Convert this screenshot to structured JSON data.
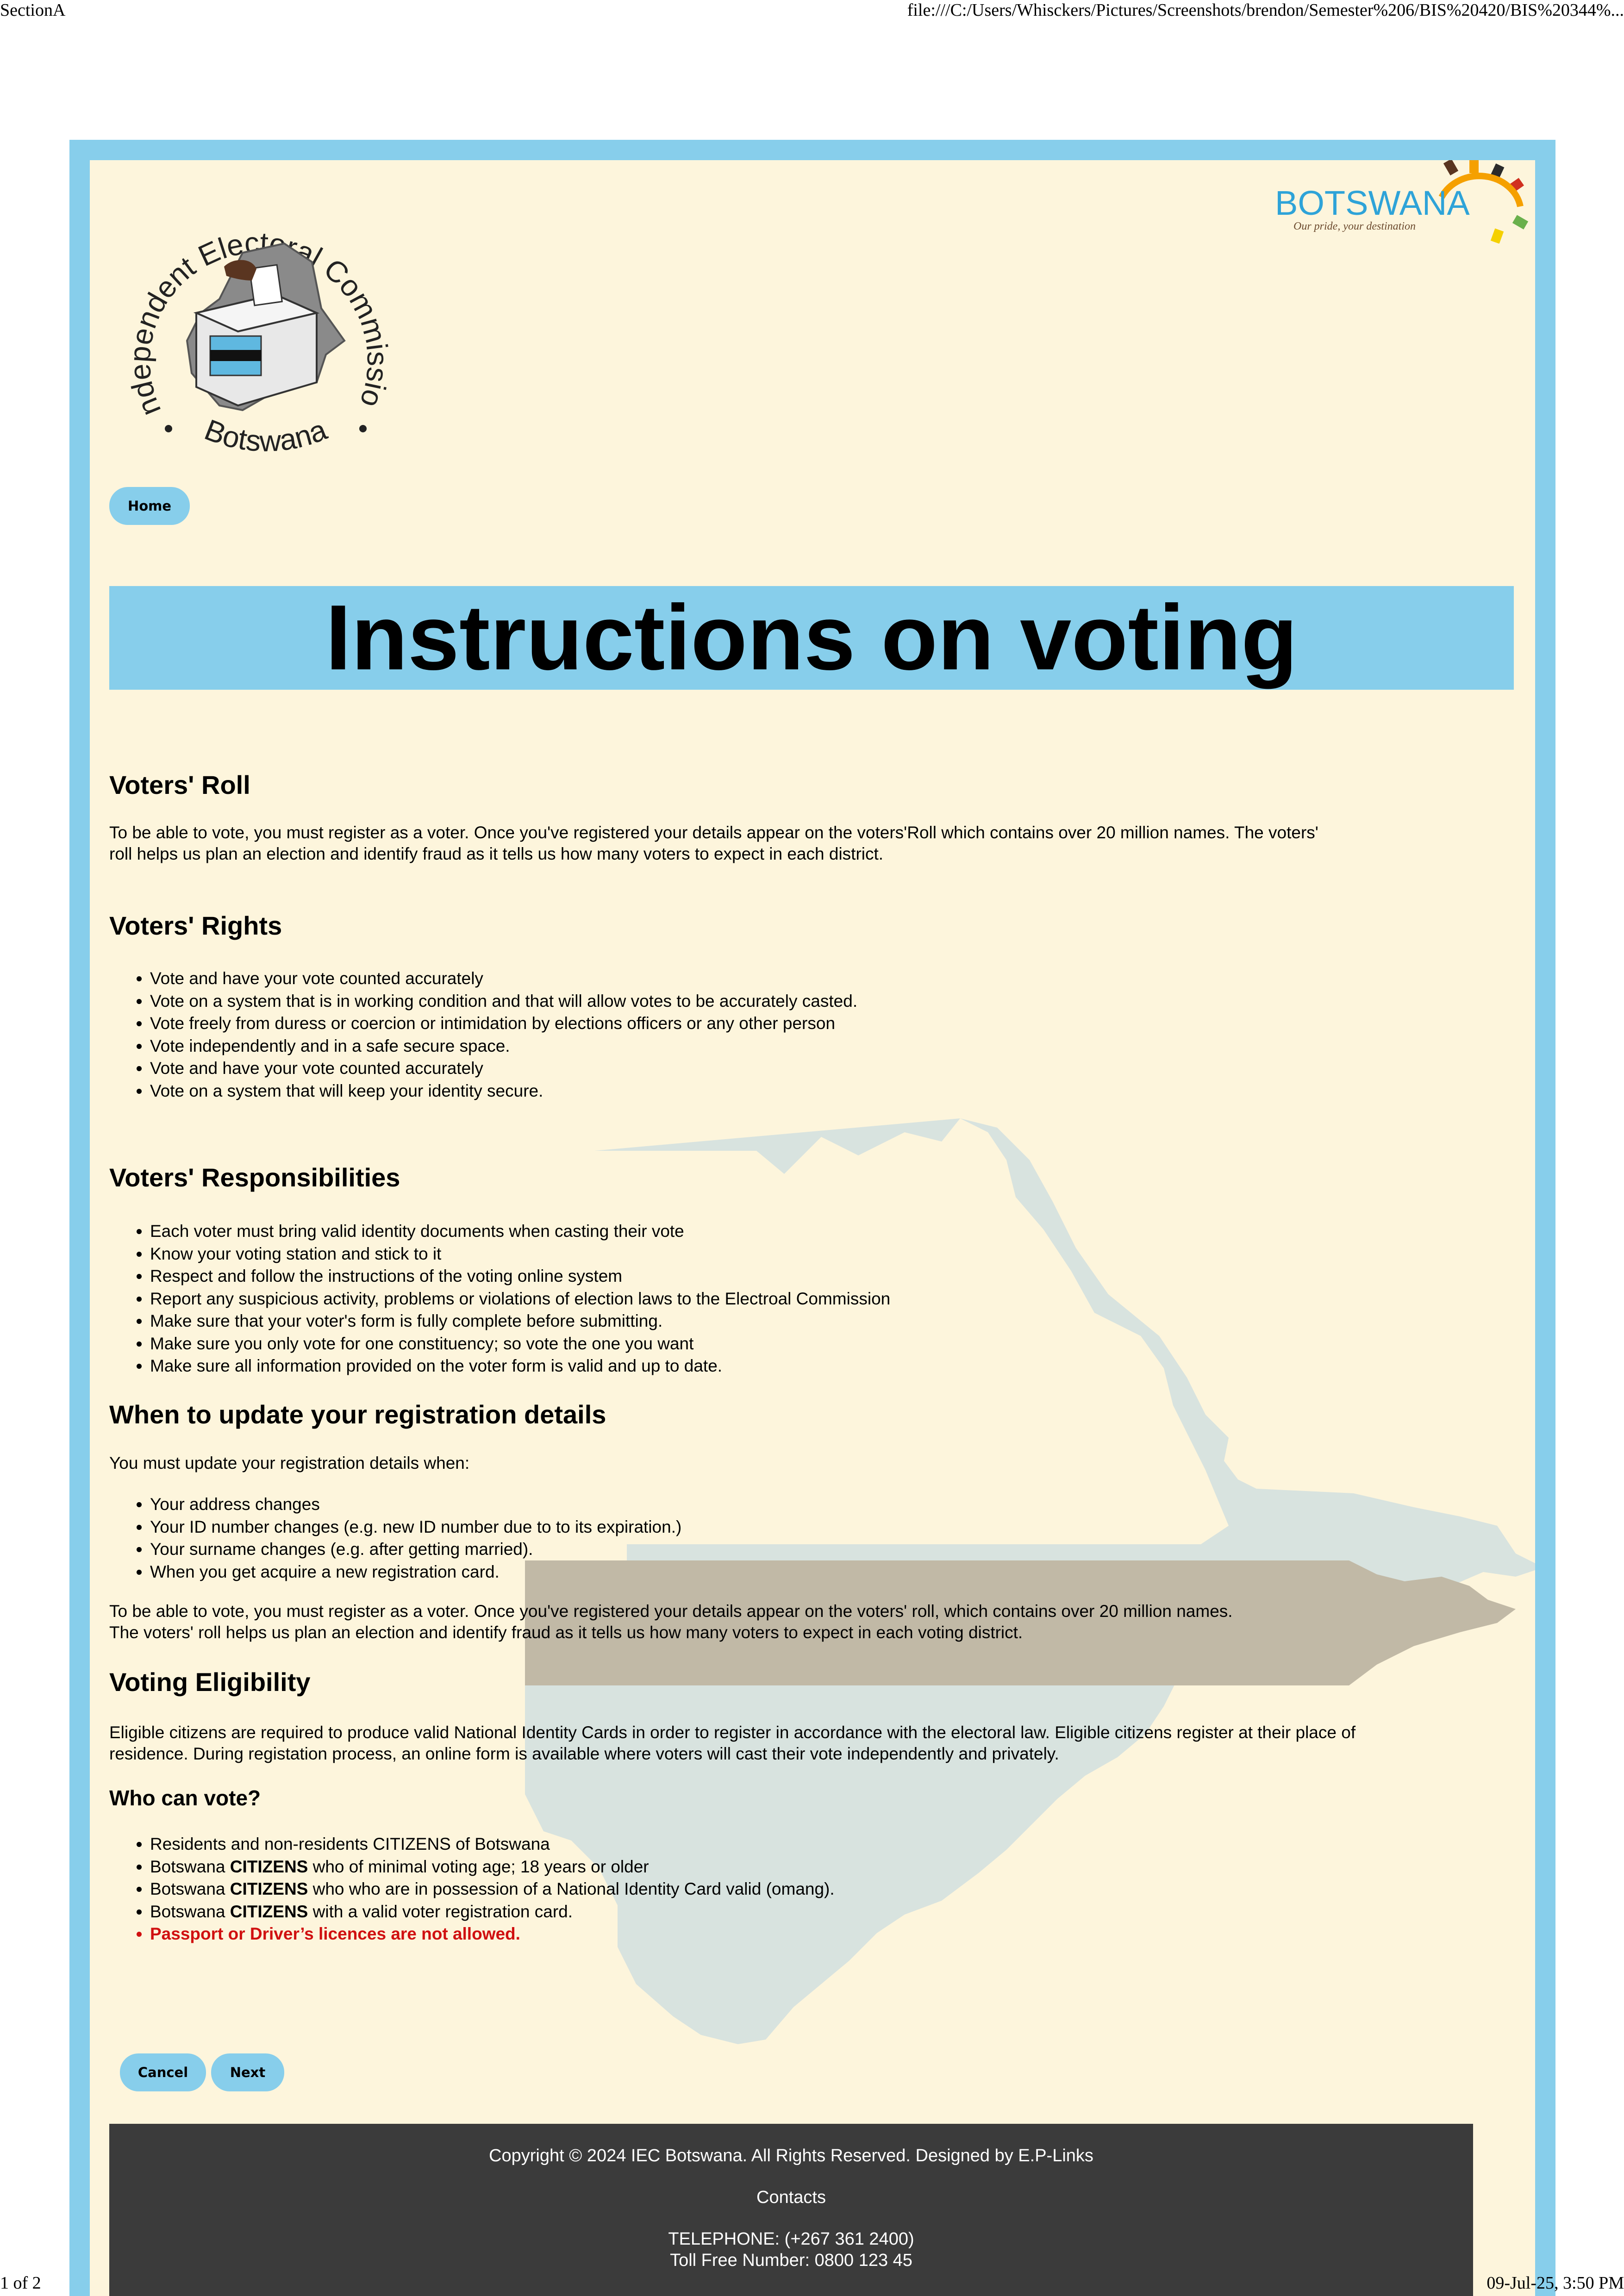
{
  "print_header": {
    "title": "SectionA",
    "url": "file:///C:/Users/Whisckers/Pictures/Screenshots/brendon/Semester%206/BIS%20420/BIS%20344%..."
  },
  "print_footer": {
    "page": "1 of 2",
    "datetime": "09-Jul-25, 3:50 PM"
  },
  "logos": {
    "iec_top": "Independent Electoral Commission",
    "iec_bottom": "Botswana",
    "botswana_word": "BOTSWANA",
    "botswana_tagline": "Our pride, your destination"
  },
  "nav": {
    "home_label": "Home"
  },
  "page_title": "Instructions on voting",
  "sections": {
    "voters_roll": {
      "heading": "Voters' Roll",
      "text": "To be able to vote, you must register as a voter. Once you've registered your details appear on the voters'Roll which contains over 20 million names. The voters' roll helps us plan an election and identify fraud as it tells us how many voters to expect in each district."
    },
    "voters_rights": {
      "heading": "Voters' Rights",
      "items": [
        "Vote and have your vote counted accurately",
        "Vote on a system that is in working condition and that will allow votes to be accurately casted.",
        "Vote freely from duress or coercion or intimidation by elections officers or any other person",
        "Vote independently and in a safe secure space.",
        "Vote and have your vote counted accurately",
        "Vote on a system that will keep your identity secure."
      ]
    },
    "voters_responsibilities": {
      "heading": "Voters' Responsibilities",
      "items": [
        "Each voter must bring valid identity documents when casting their vote",
        "Know your voting station and stick to it",
        "Respect and follow the instructions of the voting online system",
        "Report any suspicious activity, problems or violations of election laws to the Electroal Commission",
        "Make sure that your voter's form is fully complete before submitting.",
        "Make sure you only vote for one constituency; so vote the one you want",
        "Make sure all information provided on the voter form is valid and up to date."
      ]
    },
    "update_details": {
      "heading": "When to update your registration details",
      "intro": "You must update your registration details when:",
      "items": [
        "Your address changes",
        "Your ID number changes (e.g. new ID number due to to its expiration.)",
        "Your surname changes (e.g. after getting married).",
        "When you get acquire a new registration card."
      ],
      "text_line1": "To be able to vote, you must register as a voter. Once you've registered your details appear on the voters' roll, which contains over 20 million names.",
      "text_line2": "The voters' roll helps us plan an election and identify fraud as it tells us how many voters to expect in each voting district."
    },
    "eligibility": {
      "heading": "Voting Eligibility",
      "text": "Eligible citizens are required to produce valid National Identity Cards in order to register in accordance with the electoral law. Eligible citizens register at their place of residence. During registation process, an online form is available where voters will cast their vote independently and privately."
    },
    "who_can_vote": {
      "heading": "Who can vote?",
      "item1": "Residents and non-residents CITIZENS of Botswana",
      "item2_pre": "Botswana ",
      "citizens_word": "CITIZENS",
      "item2_post": " who of minimal voting age; 18 years or older",
      "item3_pre": "Botswana ",
      "item3_post": " who who are in possession of a National Identity Card valid (omang).",
      "item4_pre": "Botswana ",
      "item4_post": " with a valid voter registration card.",
      "item5_warning": "Passport or Driver’s licences are not allowed."
    }
  },
  "actions": {
    "cancel_label": "Cancel",
    "next_label": "Next"
  },
  "footer": {
    "copyright": "Copyright © 2024 IEC Botswana. All Rights Reserved. Designed by E.P-Links",
    "contacts_heading": "Contacts",
    "telephone": "TELEPHONE: (+267 361 2400)",
    "toll_free": "Toll Free Number: 0800 123 45"
  },
  "colors": {
    "accent_blue": "#87ceeb",
    "page_background": "#fdf5dc",
    "footer_background": "#3b3b3b",
    "warning_red": "#d01010"
  }
}
